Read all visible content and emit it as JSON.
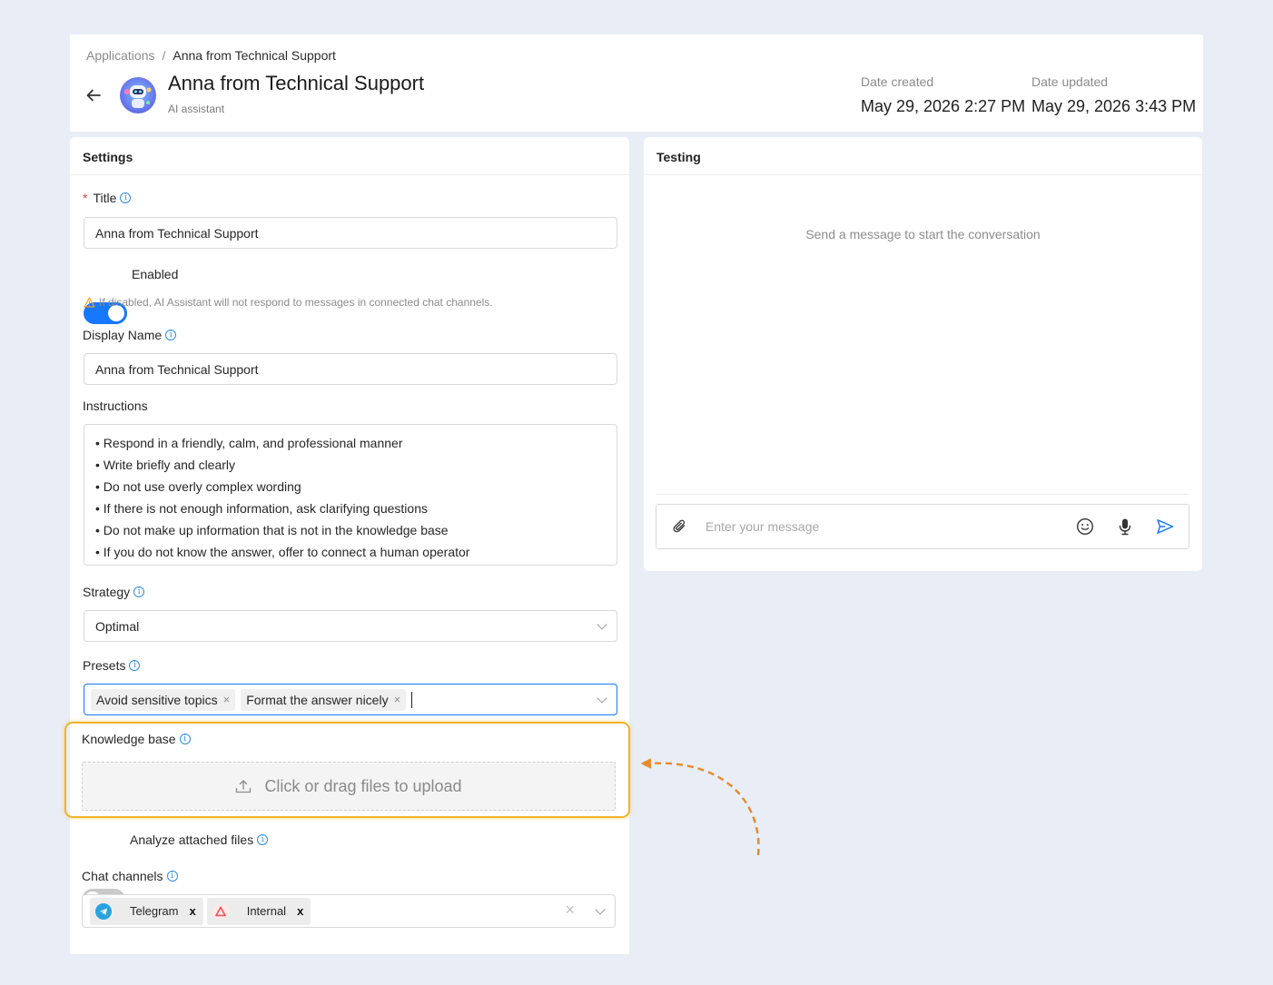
{
  "breadcrumb": {
    "root": "Applications",
    "separator": "/",
    "current": "Anna from Technical Support"
  },
  "app": {
    "title": "Anna from Technical Support",
    "subtitle": "AI assistant"
  },
  "meta": {
    "created_label": "Date created",
    "created_value": "May 29, 2026 2:27 PM",
    "updated_label": "Date updated",
    "updated_value": "May 29, 2026 3:43 PM"
  },
  "settings": {
    "heading": "Settings",
    "title_label": "Title",
    "title_value": "Anna from Technical Support",
    "enabled_label": "Enabled",
    "enabled": true,
    "enabled_hint": "If disabled, AI Assistant will not respond to messages in connected chat channels.",
    "display_name_label": "Display Name",
    "display_name_value": "Anna from Technical Support",
    "instructions_label": "Instructions",
    "instructions": [
      "• Respond in a friendly, calm, and professional manner",
      "• Write briefly and clearly",
      "• Do not use overly complex wording",
      "• If there is not enough information, ask clarifying questions",
      "• Do not make up information that is not in the knowledge base",
      "• If you do not know the answer, offer to connect a human operator"
    ],
    "strategy_label": "Strategy",
    "strategy_value": "Optimal",
    "presets_label": "Presets",
    "presets": [
      "Avoid sensitive topics",
      "Format the answer nicely"
    ],
    "tag_remove": "×",
    "knowledge_base_label": "Knowledge base",
    "upload_text": "Click or drag files to upload",
    "analyze_label": "Analyze attached files",
    "analyze_enabled": false,
    "chat_channels_label": "Chat channels",
    "chat_channels": [
      {
        "name": "Telegram",
        "icon": "telegram-icon",
        "color": "#2aa3df"
      },
      {
        "name": "Internal",
        "icon": "internal-channel-icon",
        "color": "#f04e4e"
      }
    ],
    "channel_remove": "x",
    "clear_symbol": "×"
  },
  "testing": {
    "heading": "Testing",
    "empty_message": "Send a message to start the conversation",
    "input_placeholder": "Enter your message"
  },
  "colors": {
    "accent": "#1677ff",
    "highlight": "#f0b429",
    "annotation_arrow": "#e8892b",
    "required": "#e53935"
  }
}
